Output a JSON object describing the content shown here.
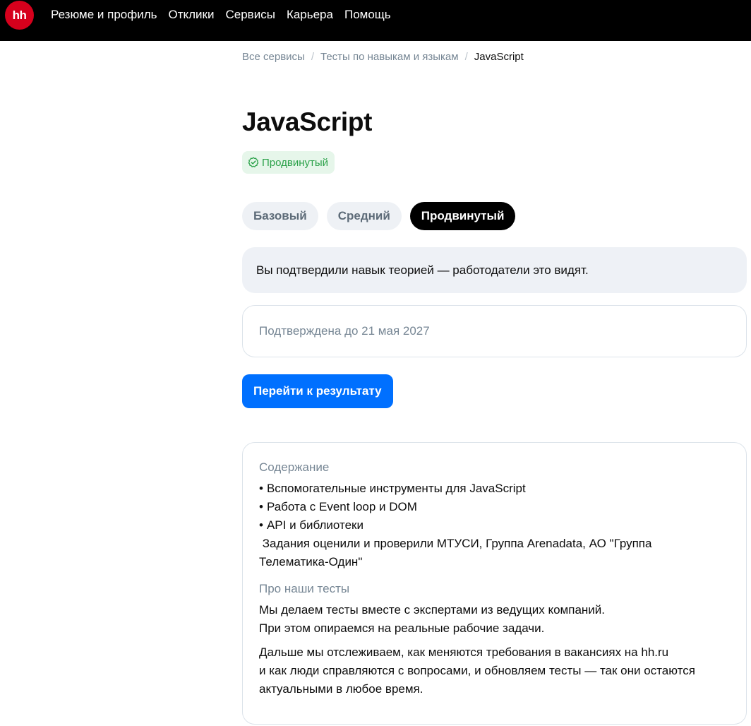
{
  "header": {
    "logo_text": "hh",
    "logo_color": "#d6001c",
    "nav_items": [
      "Резюме и профиль",
      "Отклики",
      "Сервисы",
      "Карьера",
      "Помощь"
    ]
  },
  "breadcrumb": {
    "items": [
      "Все сервисы",
      "Тесты по навыкам и языкам"
    ],
    "current": "JavaScript",
    "separator": "/"
  },
  "page": {
    "title": "JavaScript",
    "level_badge": "Продвинутый",
    "level_badge_icon": "check-circle-icon"
  },
  "tabs": {
    "items": [
      "Базовый",
      "Средний",
      "Продвинутый"
    ],
    "active_index": 2
  },
  "info_banner": {
    "text": "Вы подтвердили навык теорией — работодатели это видят."
  },
  "confirmation": {
    "text": "Подтверждена до 21 мая 2027"
  },
  "actions": {
    "result_button": "Перейти к результату",
    "accent_color": "#0070ff"
  },
  "content": {
    "heading": "Содержание",
    "bullets": [
      "Вспомогательные инструменты для JavaScript",
      "Работа с Event loop и DOM",
      "API и библиотеки"
    ],
    "evaluators": " Задания оценили и проверили МТУСИ, Группа Arenadata, АО \"Группа Телематика-Один\"",
    "about_heading": "Про наши тесты",
    "paragraphs": [
      "Мы делаем тесты вместе с экспертами из ведущих компаний.\nПри этом опираемся на реальные рабочие задачи.",
      "Дальше мы отслеживаем, как меняются требования в вакансиях на hh.ru\nи как люди справляются с вопросами, и обновляем тесты — так они остаются актуальными в любое время."
    ]
  }
}
